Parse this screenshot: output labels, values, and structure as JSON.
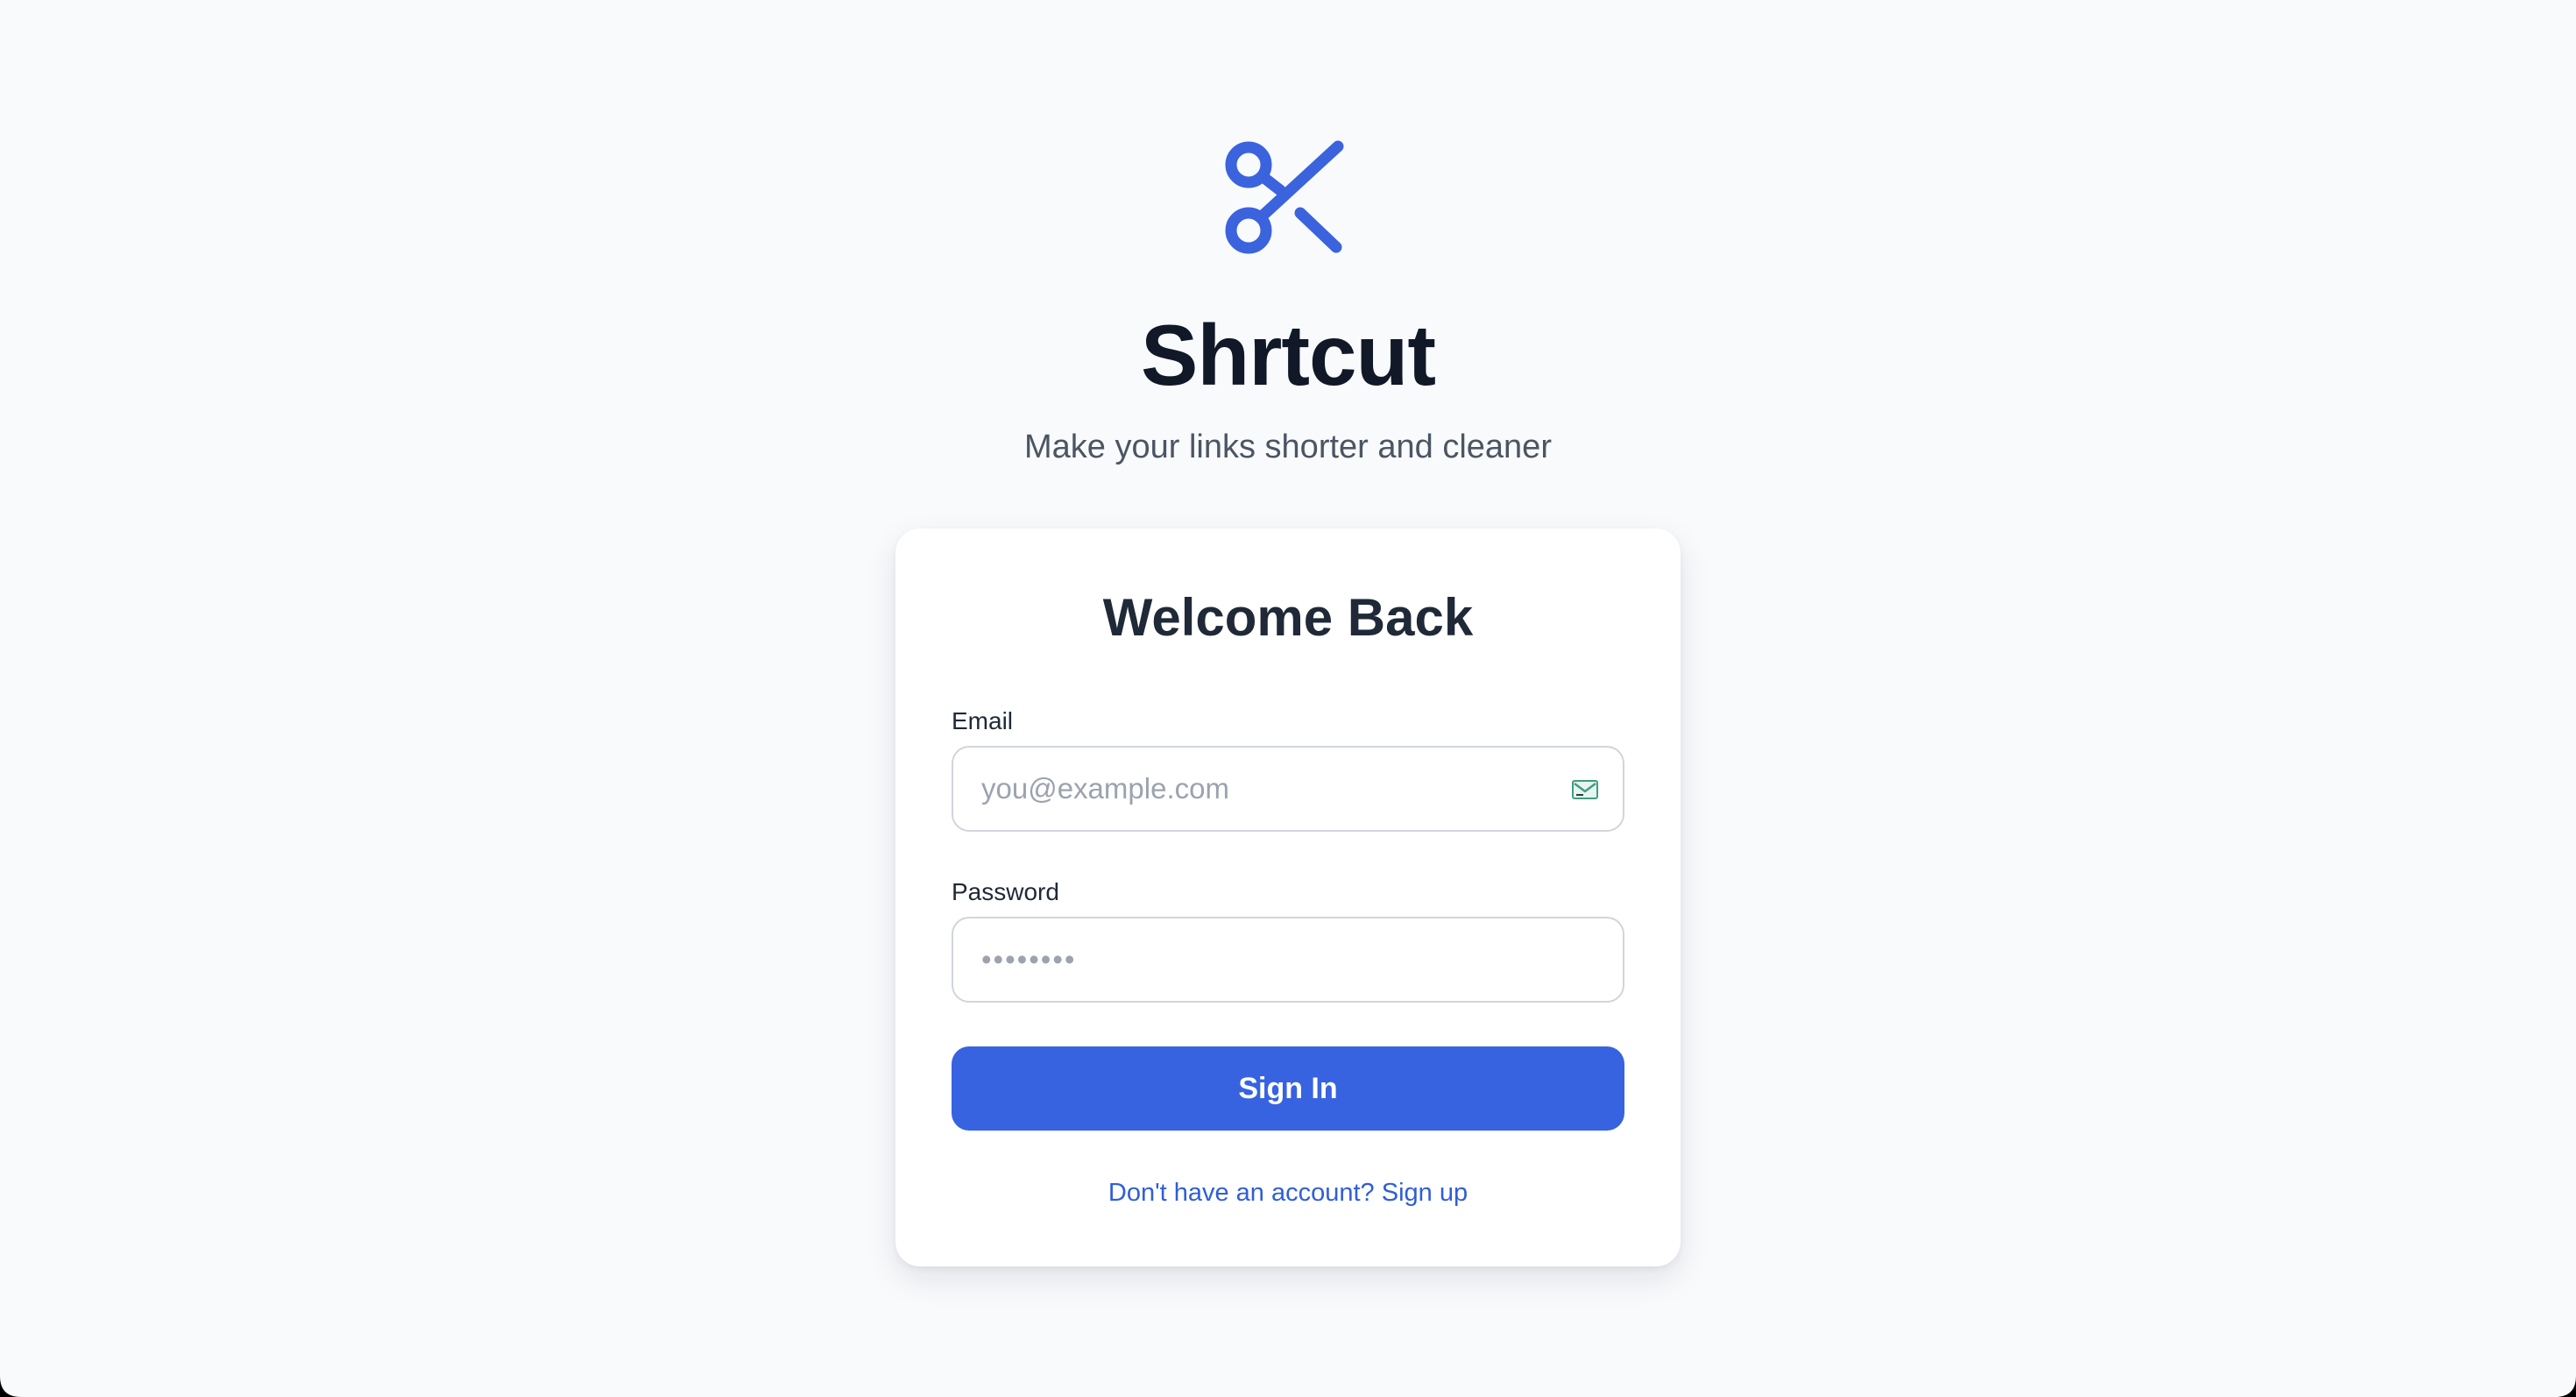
{
  "brand": {
    "logo_icon": "scissors-icon",
    "title": "Shrtcut",
    "tagline": "Make your links shorter and cleaner"
  },
  "login_card": {
    "title": "Welcome Back",
    "email": {
      "label": "Email",
      "placeholder": "you@example.com",
      "value": "",
      "icon": "mail-icon"
    },
    "password": {
      "label": "Password",
      "placeholder": "••••••••",
      "value": ""
    },
    "submit_label": "Sign In",
    "signup_link": "Don't have an account? Sign up"
  },
  "colors": {
    "page_background": "#f8fafc",
    "accent": "#3763e0",
    "logo": "#3b63dd",
    "link": "#2f5ed8",
    "mail_icon": "#3f9d83"
  }
}
